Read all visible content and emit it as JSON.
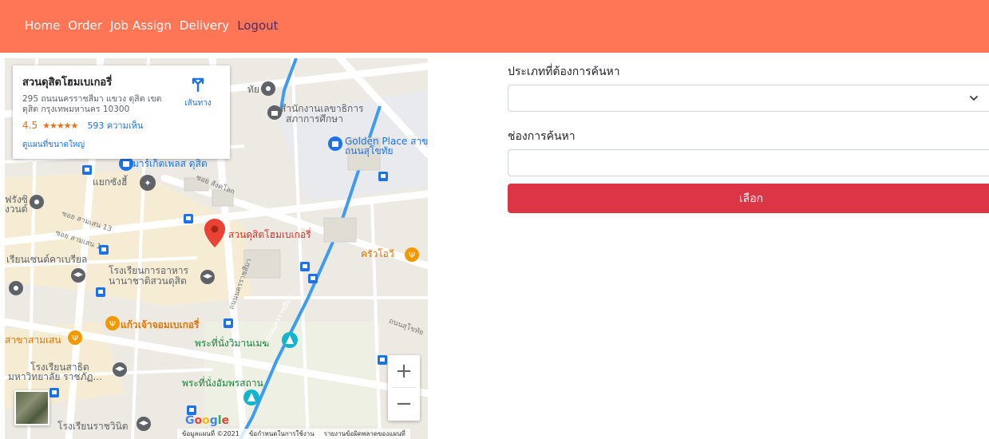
{
  "colors": {
    "navbar_bg": "#ff7656",
    "nav_text": "#ffffff",
    "nav_active_text": "#4a2c66",
    "button_bg": "#dc3545",
    "pin_red": "#ea4335",
    "road_blue": "#3d9cf0"
  },
  "nav": {
    "items": [
      {
        "label": "Home"
      },
      {
        "label": "Order"
      },
      {
        "label": "Job Assign"
      },
      {
        "label": "Delivery"
      },
      {
        "label": "Logout"
      }
    ]
  },
  "map": {
    "info_card": {
      "title": "สวนดุสิตโฮมเบเกอรี่",
      "address": "295 ถนนนครราชสีมา แขวง ดุสิต เขต ดุสิต กรุงเทพมหานคร 10300",
      "rating_value": "4.5",
      "rating_stars": "★★★★★",
      "reviews": "593 ความเห็น",
      "larger_map_link": "ดูแผนที่ขนาดใหญ่",
      "directions_label": "เส้นทาง",
      "directions_icon": "directions-icon"
    },
    "labels": [
      {
        "text": "สำนักงานเลขาธิการ",
        "color": "#5f6368"
      },
      {
        "text": "สภาการศึกษา",
        "color": "#5f6368"
      },
      {
        "text": "Golden Place สาข",
        "color": "#1a73e8"
      },
      {
        "text": "ถนนสุโขทัย",
        "color": "#1a73e8"
      },
      {
        "text": "มาร์เก็ตเพลส ดุสิต",
        "color": "#1a73e8"
      },
      {
        "text": "แยกซังฮี้",
        "color": "#5f6368"
      },
      {
        "text": "สวนดุสิตโฮมเบเกอรี่",
        "color": "#d93025"
      },
      {
        "text": "ครัวโอวี",
        "color": "#e37400"
      },
      {
        "text": "เรียนเซนต์คาเบรียล",
        "color": "#5f6368"
      },
      {
        "text": "โรงเรียนการอาหาร",
        "color": "#5f6368"
      },
      {
        "text": "นานาชาติสวนดุสิต",
        "color": "#5f6368"
      },
      {
        "text": "แก้วเจ้าจอมเบเกอรี่",
        "color": "#e37400"
      },
      {
        "text": "สาขาสามเสน",
        "color": "#e37400"
      },
      {
        "text": "พระที่นั่งวิมานเมฆ",
        "color": "#188038"
      },
      {
        "text": "โรงเรียนสาธิต",
        "color": "#5f6368"
      },
      {
        "text": "มหาวิทยาลัย ราชภัฏ...",
        "color": "#5f6368"
      },
      {
        "text": "พระที่นั่งอัมพรสถาน",
        "color": "#188038"
      },
      {
        "text": "โรงเรียนราชวินิต",
        "color": "#5f6368"
      },
      {
        "text": "ฟรังซิ",
        "color": "#5f6368"
      },
      {
        "text": "งวนต์",
        "color": "#5f6368"
      },
      {
        "text": "ทัย",
        "color": "#5f6368"
      }
    ],
    "roads": [
      {
        "text": "ซอย สามเสน 13"
      },
      {
        "text": "ซอย สามเสน 11"
      },
      {
        "text": "ซอย สังคโลก"
      },
      {
        "text": "ถนนนครราชสีมา"
      },
      {
        "text": "ถนนสุโขทัย"
      },
      {
        "text": "ถนนนครราชสีมา"
      }
    ],
    "zoom_in": "+",
    "zoom_out": "−",
    "google_logo": "Google",
    "footer": [
      "ข้อมูลแผนที่ ©2021",
      "ข้อกำหนดในการใช้งาน",
      "รายงานข้อผิดพลาดของแผนที่"
    ]
  },
  "form": {
    "search_type_label": "ประเภทที่ต้องการค้นหา",
    "search_type_value": "",
    "search_field_label": "ช่องการค้นหา",
    "search_field_value": "",
    "search_field_placeholder": "",
    "submit_label": "เลือก"
  }
}
